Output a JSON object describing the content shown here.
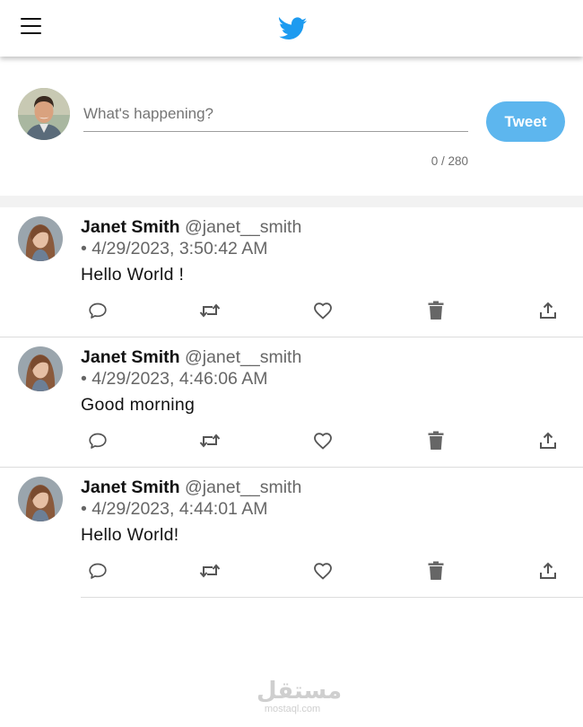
{
  "header": {
    "menu_icon": "hamburger-menu-icon",
    "logo_icon": "twitter-bird-icon",
    "brand_color": "#1d9bf0"
  },
  "composer": {
    "placeholder": "What's happening?",
    "value": "",
    "counter": "0 / 280",
    "tweet_button": "Tweet",
    "button_color": "#5db6ee"
  },
  "tweets": [
    {
      "name": "Janet Smith",
      "handle": "@janet__smith",
      "timestamp": "• 4/29/2023, 3:50:42 AM",
      "text": "Hello World !"
    },
    {
      "name": "Janet Smith",
      "handle": "@janet__smith",
      "timestamp": "• 4/29/2023, 4:46:06 AM",
      "text": "Good morning"
    },
    {
      "name": "Janet Smith",
      "handle": "@janet__smith",
      "timestamp": "• 4/29/2023, 4:44:01 AM",
      "text": "Hello World!"
    }
  ],
  "actions": [
    "reply-icon",
    "retweet-icon",
    "like-icon",
    "delete-icon",
    "share-icon"
  ],
  "watermark": {
    "arabic": "مستقل",
    "latin": "mostaql.com"
  }
}
